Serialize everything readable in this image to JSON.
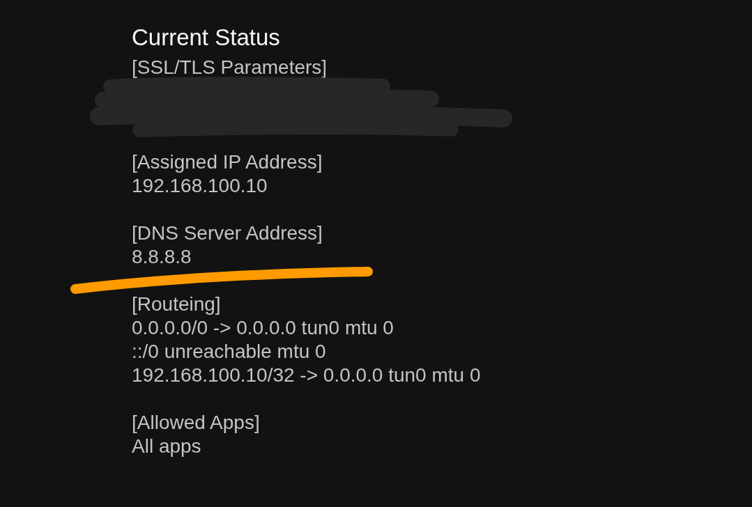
{
  "title": "Current Status",
  "sections": [
    {
      "label": "[SSL/TLS Parameters]",
      "redacted": true,
      "underlined": false
    },
    {
      "label": "[Assigned IP Address]",
      "lines": [
        "192.168.100.10"
      ],
      "redacted": false,
      "underlined": false
    },
    {
      "label": "[DNS Server Address]",
      "lines": [
        "8.8.8.8"
      ],
      "redacted": false,
      "underlined": true
    },
    {
      "label": "[Routeing]",
      "lines": [
        "0.0.0.0/0 -> 0.0.0.0 tun0 mtu 0",
        "::/0 unreachable mtu 0",
        "192.168.100.10/32 -> 0.0.0.0 tun0 mtu 0"
      ],
      "redacted": false,
      "underlined": false
    },
    {
      "label": "[Allowed Apps]",
      "lines": [
        "All apps"
      ],
      "redacted": false,
      "underlined": false
    }
  ]
}
